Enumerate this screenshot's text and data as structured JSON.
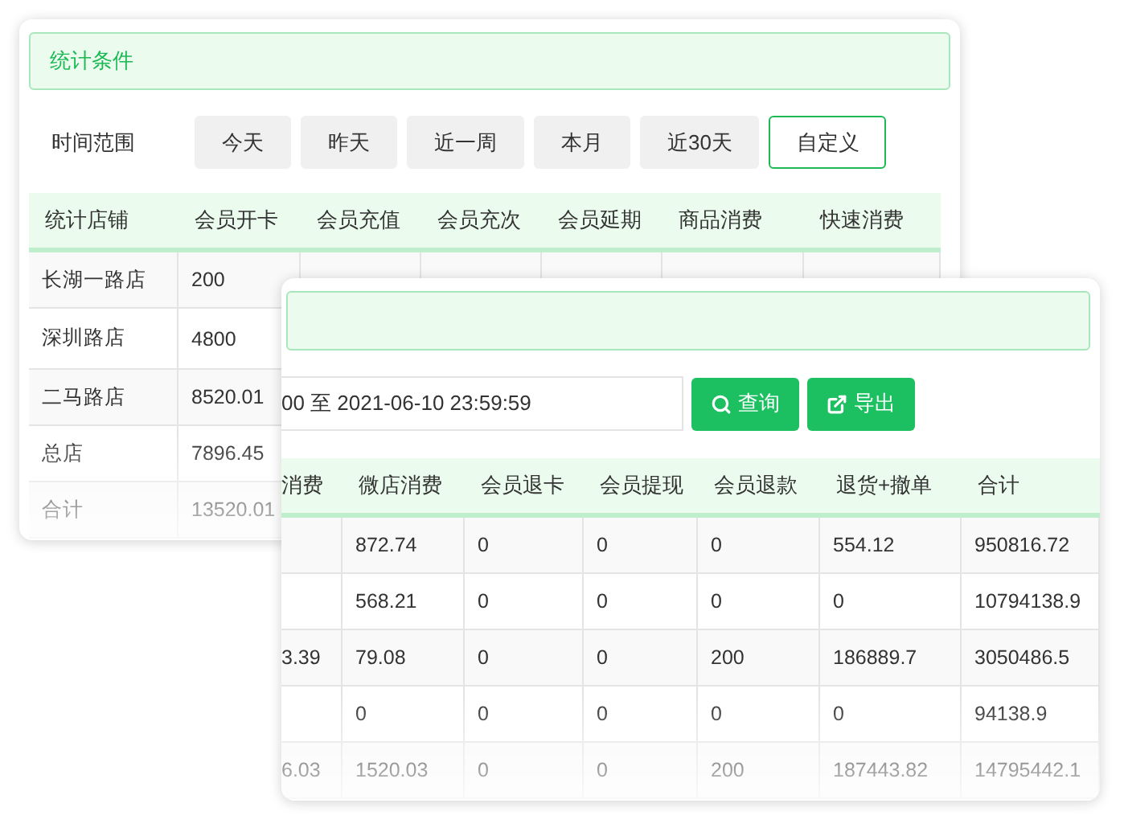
{
  "stats_card": {
    "banner": "统计条件",
    "time_range": {
      "label": "时间范围",
      "options": [
        {
          "label": "今天",
          "selected": false
        },
        {
          "label": "昨天",
          "selected": false
        },
        {
          "label": "近一周",
          "selected": false
        },
        {
          "label": "本月",
          "selected": false
        },
        {
          "label": "近30天",
          "selected": false
        },
        {
          "label": "自定义",
          "selected": true
        }
      ]
    },
    "table": {
      "columns": [
        "统计店铺",
        "会员开卡",
        "会员充值",
        "会员充次",
        "会员延期",
        "商品消费",
        "快速消费"
      ],
      "rows": [
        [
          "长湖一路店",
          "200"
        ],
        [
          "深圳路店",
          "4800"
        ],
        [
          "二马路店",
          "8520.01"
        ],
        [
          "总店",
          "7896.45"
        ],
        [
          "合计",
          "13520.01"
        ]
      ]
    }
  },
  "result_card": {
    "date_range": {
      "value": "00 至 2021-06-10 23:59:59"
    },
    "buttons": [
      {
        "kind": "search",
        "label": "查询"
      },
      {
        "kind": "export",
        "label": "导出"
      }
    ],
    "table": {
      "columns": [
        "消费",
        "微店消费",
        "会员退卡",
        "会员提现",
        "会员退款",
        "退货+撤单",
        "合计"
      ],
      "rows": [
        [
          "",
          "872.74",
          "0",
          "0",
          "0",
          "554.12",
          "950816.72"
        ],
        [
          "",
          "568.21",
          "0",
          "0",
          "0",
          "0",
          "10794138.9"
        ],
        [
          "3.39",
          "79.08",
          "0",
          "0",
          "200",
          "186889.7",
          "3050486.5"
        ],
        [
          "",
          "0",
          "0",
          "0",
          "0",
          "0",
          "94138.9"
        ],
        [
          "6.03",
          "1520.03",
          "0",
          "0",
          "200",
          "187443.82",
          "14795442.1"
        ]
      ]
    }
  }
}
